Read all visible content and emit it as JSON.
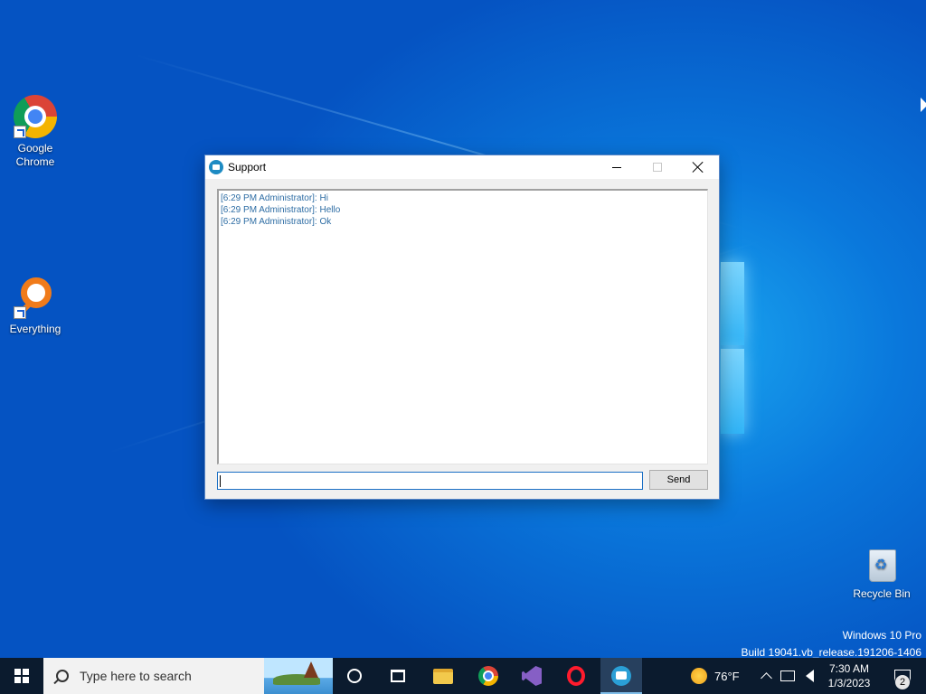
{
  "desktop": {
    "icons": [
      {
        "label": "Google Chrome",
        "icon": "chrome-icon"
      },
      {
        "label": "Everything",
        "icon": "everything-icon"
      },
      {
        "label": "Recycle Bin",
        "icon": "recycle-bin-icon"
      }
    ],
    "watermark": {
      "line1": "Windows 10 Pro",
      "line2": "Build 19041.vb_release.191206-1406"
    }
  },
  "window": {
    "title": "Support",
    "app_icon": "support-chat-icon",
    "messages": [
      "[6:29 PM Administrator]: Hi",
      "[6:29 PM Administrator]: Hello",
      "[6:29 PM Administrator]: Ok"
    ],
    "message_color": "#2e6da4",
    "input_value": "",
    "send_label": "Send"
  },
  "taskbar": {
    "search_placeholder": "Type here to search",
    "apps": [
      {
        "name": "cortana",
        "icon": "cortana-icon"
      },
      {
        "name": "task-view",
        "icon": "task-view-icon"
      },
      {
        "name": "file-explorer",
        "icon": "folder-icon"
      },
      {
        "name": "chrome",
        "icon": "chrome-icon"
      },
      {
        "name": "visual-studio",
        "icon": "visual-studio-icon"
      },
      {
        "name": "opera",
        "icon": "opera-icon"
      },
      {
        "name": "support",
        "icon": "support-chat-icon",
        "active": true
      }
    ],
    "weather": "76°F",
    "time": "7:30 AM",
    "date": "1/3/2023",
    "notification_count": "2",
    "accent": "#0b1b2e"
  }
}
